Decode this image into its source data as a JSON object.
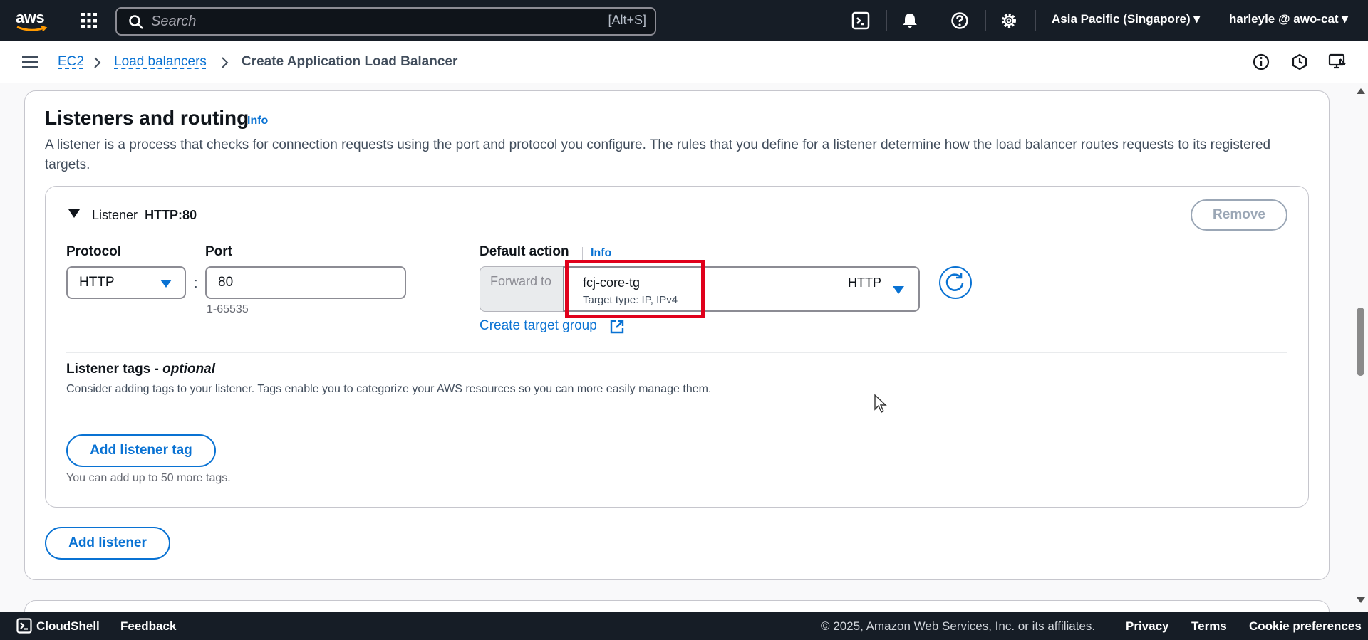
{
  "topnav": {
    "logo_text": "aws",
    "search_placeholder": "Search",
    "search_shortcut": "[Alt+S]",
    "region": "Asia Pacific (Singapore) ▾",
    "user": "harleyle @ awo-cat ▾"
  },
  "breadcrumb": {
    "items": [
      "EC2",
      "Load balancers",
      "Create Application Load Balancer"
    ]
  },
  "section": {
    "title": "Listeners and routing",
    "info": "Info",
    "description": "A listener is a process that checks for connection requests using the port and protocol you configure. The rules that you define for a listener determine how the load balancer routes requests to its registered targets."
  },
  "listener": {
    "label": "Listener",
    "name": "HTTP:80",
    "remove_label": "Remove",
    "protocol_label": "Protocol",
    "protocol_value": "HTTP",
    "port_label": "Port",
    "port_value": "80",
    "port_hint": "1-65535",
    "colon": ":",
    "default_action_label": "Default action",
    "default_action_info": "Info",
    "forward_to": "Forward to",
    "target_group_name": "fcj-core-tg",
    "target_group_type": "Target type: IP, IPv4",
    "target_group_protocol": "HTTP",
    "create_target_group": "Create target group",
    "tags_title": "Listener tags - ",
    "tags_optional": "optional",
    "tags_description": "Consider adding tags to your listener. Tags enable you to categorize your AWS resources so you can more easily manage them.",
    "add_tag_label": "Add listener tag",
    "tags_hint": "You can add up to 50 more tags."
  },
  "add_listener_label": "Add listener",
  "footer": {
    "cloudshell": "CloudShell",
    "feedback": "Feedback",
    "copyright": "© 2025, Amazon Web Services, Inc. or its affiliates.",
    "privacy": "Privacy",
    "terms": "Terms",
    "cookie": "Cookie preferences"
  },
  "colors": {
    "nav_bg": "#161d26",
    "accent": "#0972d3",
    "highlight": "#e0001b"
  },
  "icons": [
    "grid-icon",
    "search-icon",
    "cloudshell-icon",
    "bell-icon",
    "help-icon",
    "settings-icon",
    "menu-icon",
    "info-icon",
    "notifications-icon",
    "feedback-icon",
    "refresh-icon",
    "external-link-icon",
    "cursor-icon"
  ]
}
